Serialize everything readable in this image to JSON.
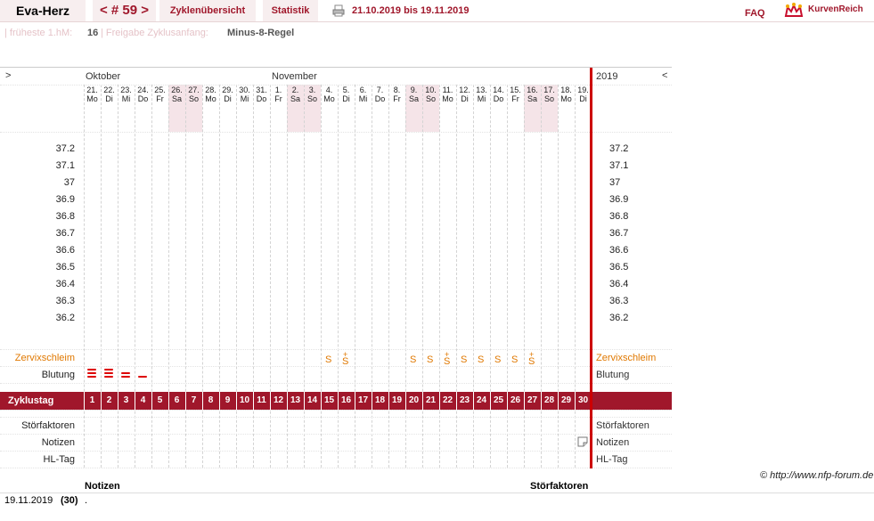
{
  "header": {
    "user": "Eva-Herz",
    "cycle": "< # 59 >",
    "tabs": [
      "Zyklenübersicht",
      "Statistik"
    ],
    "date_range": "21.10.2019 bis 19.11.2019",
    "faq": "FAQ",
    "logo_text": "KurvenReich"
  },
  "info": {
    "label1": "| früheste 1.hM:",
    "value1": "16",
    "label2": "| Freigabe Zyklusanfang:",
    "value2": "Minus-8-Regel"
  },
  "chart": {
    "nav_left": ">",
    "nav_right": "<",
    "year": "2019",
    "month1": "Oktober",
    "month2": "November",
    "days": [
      {
        "d": "21.",
        "w": "Mo"
      },
      {
        "d": "22.",
        "w": "Di"
      },
      {
        "d": "23.",
        "w": "Mi"
      },
      {
        "d": "24.",
        "w": "Do"
      },
      {
        "d": "25.",
        "w": "Fr"
      },
      {
        "d": "26.",
        "w": "Sa",
        "we": true
      },
      {
        "d": "27.",
        "w": "So",
        "we": true
      },
      {
        "d": "28.",
        "w": "Mo"
      },
      {
        "d": "29.",
        "w": "Di"
      },
      {
        "d": "30.",
        "w": "Mi"
      },
      {
        "d": "31.",
        "w": "Do"
      },
      {
        "d": "1.",
        "w": "Fr"
      },
      {
        "d": "2.",
        "w": "Sa",
        "we": true
      },
      {
        "d": "3.",
        "w": "So",
        "we": true
      },
      {
        "d": "4.",
        "w": "Mo"
      },
      {
        "d": "5.",
        "w": "Di"
      },
      {
        "d": "6.",
        "w": "Mi"
      },
      {
        "d": "7.",
        "w": "Do"
      },
      {
        "d": "8.",
        "w": "Fr"
      },
      {
        "d": "9.",
        "w": "Sa",
        "we": true
      },
      {
        "d": "10.",
        "w": "So",
        "we": true
      },
      {
        "d": "11.",
        "w": "Mo"
      },
      {
        "d": "12.",
        "w": "Di"
      },
      {
        "d": "13.",
        "w": "Mi"
      },
      {
        "d": "14.",
        "w": "Do"
      },
      {
        "d": "15.",
        "w": "Fr"
      },
      {
        "d": "16.",
        "w": "Sa",
        "we": true
      },
      {
        "d": "17.",
        "w": "So",
        "we": true
      },
      {
        "d": "18.",
        "w": "Mo"
      },
      {
        "d": "19.",
        "w": "Di"
      }
    ],
    "temps": [
      "37.2",
      "37.1",
      "37",
      "36.9",
      "36.8",
      "36.7",
      "36.6",
      "36.5",
      "36.4",
      "36.3",
      "36.2"
    ],
    "row_labels": {
      "zervix": "Zervixschleim",
      "blutung": "Blutung",
      "zyklustag": "Zyklustag",
      "stoer": "Störfaktoren",
      "notizen": "Notizen",
      "hl": "HL-Tag"
    },
    "zervix": {
      "15": "S",
      "16": "S+",
      "20": "S",
      "21": "S",
      "22": "S+",
      "23": "S",
      "24": "S",
      "25": "S",
      "26": "S",
      "27": "S+"
    },
    "blutung": {
      "1": 3,
      "2": 3,
      "3": 2,
      "4": 1
    },
    "note_day": 30
  },
  "credit": "© http://www.nfp-forum.de",
  "footer": {
    "col_notizen": "Notizen",
    "col_stoer": "Störfaktoren",
    "date": "19.11.2019",
    "day": "(30)",
    "note": "."
  },
  "colors": {
    "accent": "#a0172b",
    "weekend": "#f5e4e8",
    "zervix": "#e07800",
    "blood": "#d00000"
  }
}
